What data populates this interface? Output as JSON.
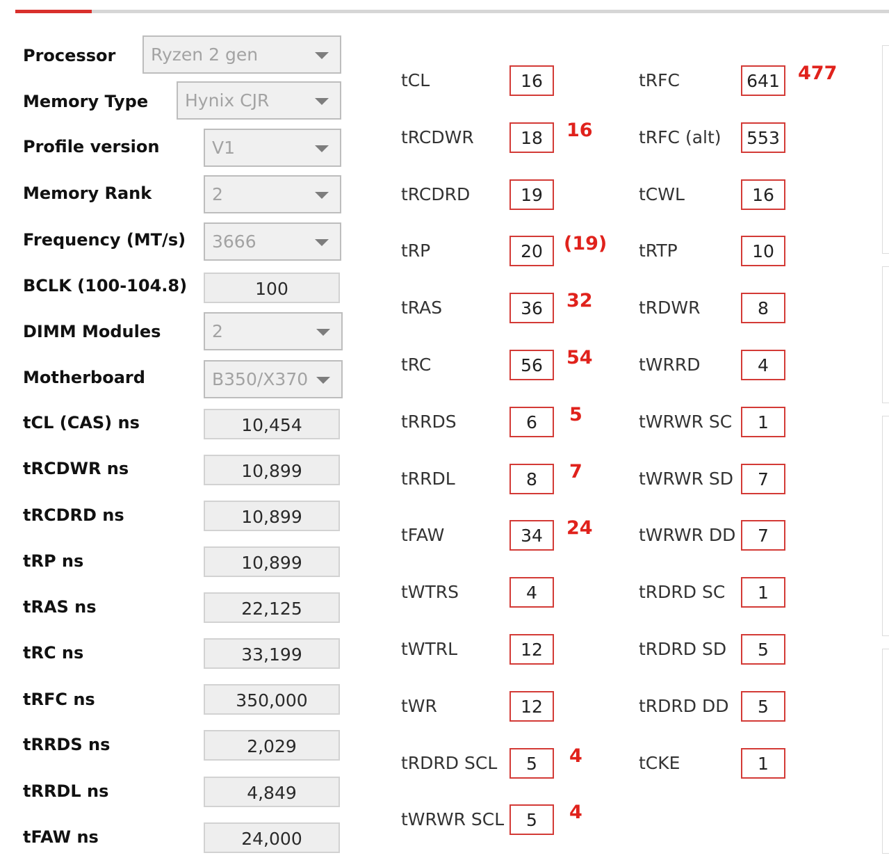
{
  "settings": [
    {
      "label": "Processor",
      "kind": "select",
      "value": "Ryzen 2 gen"
    },
    {
      "label": "Memory Type",
      "kind": "select",
      "value": "Hynix CJR"
    },
    {
      "label": "Profile version",
      "kind": "select",
      "value": "V1"
    },
    {
      "label": "Memory Rank",
      "kind": "select",
      "value": "2"
    },
    {
      "label": "Frequency (MT/s)",
      "kind": "select",
      "value": "3666"
    },
    {
      "label": "BCLK (100-104.8)",
      "kind": "field",
      "value": "100"
    },
    {
      "label": "DIMM Modules",
      "kind": "select",
      "value": "2"
    },
    {
      "label": "Motherboard",
      "kind": "select",
      "value": "B350/X370"
    },
    {
      "label": "tCL (CAS) ns",
      "kind": "field",
      "value": "10,454"
    },
    {
      "label": "tRCDWR ns",
      "kind": "field",
      "value": "10,899"
    },
    {
      "label": "tRCDRD ns",
      "kind": "field",
      "value": "10,899"
    },
    {
      "label": "tRP ns",
      "kind": "field",
      "value": "10,899"
    },
    {
      "label": "tRAS ns",
      "kind": "field",
      "value": "22,125"
    },
    {
      "label": "tRC ns",
      "kind": "field",
      "value": "33,199"
    },
    {
      "label": "tRFC ns",
      "kind": "field",
      "value": "350,000"
    },
    {
      "label": "tRRDS ns",
      "kind": "field",
      "value": "2,029"
    },
    {
      "label": "tRRDL ns",
      "kind": "field",
      "value": "4,849"
    },
    {
      "label": "tFAW ns",
      "kind": "field",
      "value": "24,000"
    }
  ],
  "timings_primary": [
    {
      "label": "tCL",
      "value": "16",
      "note": ""
    },
    {
      "label": "tRCDWR",
      "value": "18",
      "note": "16"
    },
    {
      "label": "tRCDRD",
      "value": "19",
      "note": ""
    },
    {
      "label": "tRP",
      "value": "20",
      "note": "(19)"
    },
    {
      "label": "tRAS",
      "value": "36",
      "note": "32"
    },
    {
      "label": "tRC",
      "value": "56",
      "note": "54"
    },
    {
      "label": "tRRDS",
      "value": "6",
      "note": "5"
    },
    {
      "label": "tRRDL",
      "value": "8",
      "note": "7"
    },
    {
      "label": "tFAW",
      "value": "34",
      "note": "24"
    },
    {
      "label": "tWTRS",
      "value": "4",
      "note": ""
    },
    {
      "label": "tWTRL",
      "value": "12",
      "note": ""
    },
    {
      "label": "tWR",
      "value": "12",
      "note": ""
    },
    {
      "label": "tRDRD SCL",
      "value": "5",
      "note": "4"
    },
    {
      "label": "tWRWR SCL",
      "value": "5",
      "note": "4"
    }
  ],
  "timings_secondary": [
    {
      "label": "tRFC",
      "value": "641",
      "note": "477"
    },
    {
      "label": "tRFC (alt)",
      "value": "553",
      "note": ""
    },
    {
      "label": "tCWL",
      "value": "16",
      "note": ""
    },
    {
      "label": "tRTP",
      "value": "10",
      "note": ""
    },
    {
      "label": "tRDWR",
      "value": "8",
      "note": ""
    },
    {
      "label": "tWRRD",
      "value": "4",
      "note": ""
    },
    {
      "label": "tWRWR SC",
      "value": "1",
      "note": ""
    },
    {
      "label": "tWRWR SD",
      "value": "7",
      "note": ""
    },
    {
      "label": "tWRWR DD",
      "value": "7",
      "note": ""
    },
    {
      "label": "tRDRD SC",
      "value": "1",
      "note": ""
    },
    {
      "label": "tRDRD SD",
      "value": "5",
      "note": ""
    },
    {
      "label": "tRDRD DD",
      "value": "5",
      "note": ""
    },
    {
      "label": "tCKE",
      "value": "1",
      "note": ""
    }
  ],
  "colors": {
    "accent": "#d9302c",
    "annotation": "#e0221c",
    "box_border": "#d33a36"
  }
}
